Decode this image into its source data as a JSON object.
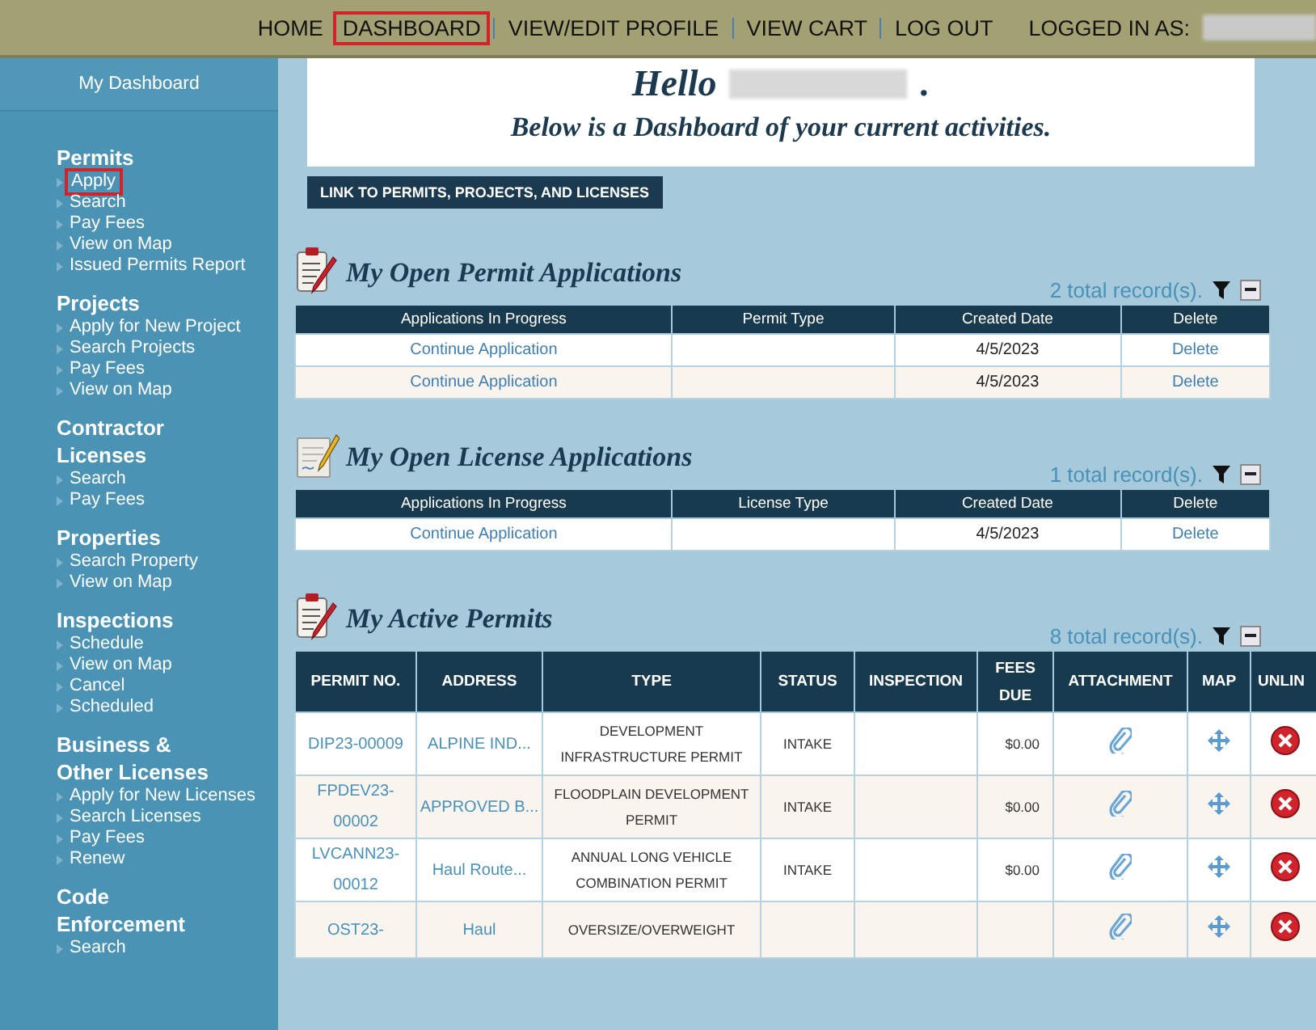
{
  "top_nav": {
    "items": [
      {
        "label": "HOME",
        "highlighted": false
      },
      {
        "label": "DASHBOARD",
        "highlighted": true
      },
      {
        "label": "VIEW/EDIT PROFILE",
        "highlighted": false
      },
      {
        "label": "VIEW CART",
        "highlighted": false
      },
      {
        "label": "LOG OUT",
        "highlighted": false
      }
    ],
    "logged_in_label": "LOGGED IN AS:"
  },
  "sidebar": {
    "title": "My Dashboard",
    "sections": [
      {
        "heading": "Permits",
        "links": [
          {
            "label": "Apply",
            "highlighted": true
          },
          {
            "label": "Search",
            "highlighted": false
          },
          {
            "label": "Pay Fees",
            "highlighted": false
          },
          {
            "label": "View on Map",
            "highlighted": false
          },
          {
            "label": "Issued Permits Report",
            "highlighted": false
          }
        ]
      },
      {
        "heading": "Projects",
        "links": [
          {
            "label": "Apply for New Project",
            "highlighted": false
          },
          {
            "label": "Search Projects",
            "highlighted": false
          },
          {
            "label": "Pay Fees",
            "highlighted": false
          },
          {
            "label": "View on Map",
            "highlighted": false
          }
        ]
      },
      {
        "heading": "Contractor Licenses",
        "links": [
          {
            "label": "Search",
            "highlighted": false
          },
          {
            "label": "Pay Fees",
            "highlighted": false
          }
        ]
      },
      {
        "heading": "Properties",
        "links": [
          {
            "label": "Search Property",
            "highlighted": false
          },
          {
            "label": "View on Map",
            "highlighted": false
          }
        ]
      },
      {
        "heading": "Inspections",
        "links": [
          {
            "label": "Schedule",
            "highlighted": false
          },
          {
            "label": "View on Map",
            "highlighted": false
          },
          {
            "label": "Cancel",
            "highlighted": false
          },
          {
            "label": "Scheduled",
            "highlighted": false
          }
        ]
      },
      {
        "heading": "Business & Other Licenses",
        "links": [
          {
            "label": "Apply for New Licenses",
            "highlighted": false
          },
          {
            "label": "Search Licenses",
            "highlighted": false
          },
          {
            "label": "Pay Fees",
            "highlighted": false
          },
          {
            "label": "Renew",
            "highlighted": false
          }
        ]
      },
      {
        "heading": "Code Enforcement",
        "links": [
          {
            "label": "Search",
            "highlighted": false
          }
        ]
      }
    ]
  },
  "greeting": {
    "hello": "Hello",
    "end": ".",
    "subtitle": "Below is a Dashboard of your current activities."
  },
  "link_button": "LINK TO PERMITS, PROJECTS, AND LICENSES",
  "panels": [
    {
      "kind": "applications",
      "title": "My Open Permit Applications",
      "records": "2 total record(s).",
      "columns": [
        "Applications In Progress",
        "Permit Type",
        "Created Date",
        "Delete"
      ],
      "rows": [
        {
          "application": "Continue Application",
          "created_date": "4/5/2023",
          "delete": "Delete"
        },
        {
          "application": "Continue Application",
          "created_date": "4/5/2023",
          "delete": "Delete"
        }
      ]
    },
    {
      "kind": "applications",
      "title": "My Open License Applications",
      "records": "1 total record(s).",
      "columns": [
        "Applications In Progress",
        "License Type",
        "Created Date",
        "Delete"
      ],
      "rows": [
        {
          "application": "Continue Application",
          "created_date": "4/5/2023",
          "delete": "Delete"
        }
      ]
    },
    {
      "kind": "permits",
      "title": "My Active Permits",
      "records": "8 total record(s).",
      "columns": [
        "PERMIT NO.",
        "ADDRESS",
        "TYPE",
        "STATUS",
        "INSPECTION",
        "FEES DUE",
        "ATTACHMENT",
        "MAP",
        "UNLIN"
      ],
      "rows": [
        {
          "permit_no": "DIP23-00009",
          "address": "ALPINE IND...",
          "type": "DEVELOPMENT INFRASTRUCTURE PERMIT",
          "status": "INTAKE",
          "fees_due": "$0.00"
        },
        {
          "permit_no": "FPDEV23-00002",
          "address": "APPROVED B...",
          "type": "FLOODPLAIN DEVELOPMENT PERMIT",
          "status": "INTAKE",
          "fees_due": "$0.00"
        },
        {
          "permit_no": "LVCANN23-00012",
          "address": "Haul Route...",
          "type": "ANNUAL LONG VEHICLE COMBINATION PERMIT",
          "status": "INTAKE",
          "fees_due": "$0.00"
        },
        {
          "permit_no": "OST23-",
          "address": "Haul",
          "type": "OVERSIZE/OVERWEIGHT"
        }
      ]
    }
  ]
}
